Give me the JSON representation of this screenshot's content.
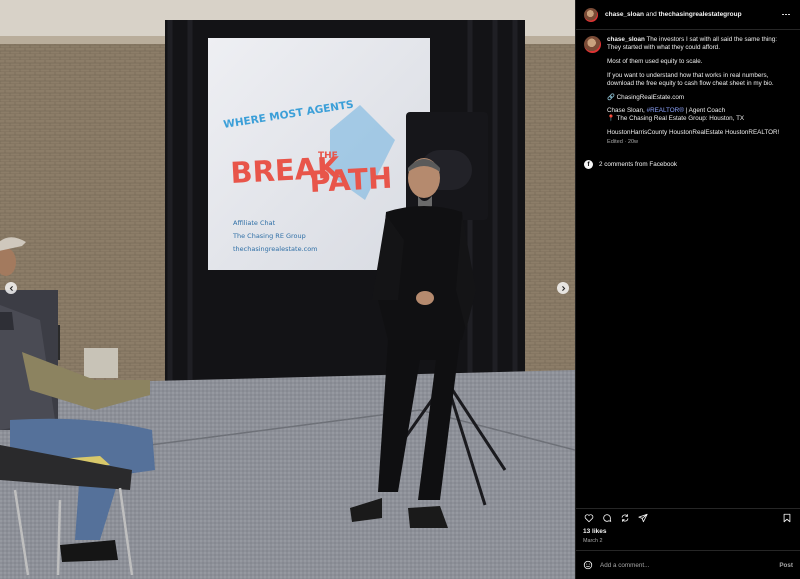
{
  "header": {
    "username": "chase_sloan",
    "conjunction": "and",
    "collaborator": "thechasingrealestategroup",
    "more_icon": "more-horizontal-icon"
  },
  "slide": {
    "line1": "WHERE MOST AGENTS",
    "line2a": "BREAK",
    "line2b": "THE",
    "line2c": "PATH",
    "small1": "Affiliate Chat",
    "small2": "The Chasing RE Group",
    "small3": "thechasingrealestate.com"
  },
  "caption": {
    "username": "chase_sloan",
    "line1": "The investors I sat with all said the same thing: They started with what they could afford.",
    "line2": "Most of them used equity to scale.",
    "line3": "If you want to understand how that works in real numbers, download the free equity to cash flow cheat sheet in my bio.",
    "link": "🔗 ChasingRealEstate.com",
    "bio_name": "Chase Sloan, ",
    "bio_tag": "#REALTOR®",
    "bio_role": " | Agent Coach",
    "location": "📍 The Chasing Real Estate Group: Houston, TX",
    "hashtags": "HoustonHarrisCounty HoustonRealEstate HoustonREALTOR!",
    "edited": "Edited · 20w"
  },
  "comments": {
    "text": "2 comments from Facebook",
    "icon": "facebook-icon"
  },
  "actions": {
    "icons": [
      "heart-icon",
      "comment-icon",
      "repost-icon",
      "share-icon",
      "bookmark-icon"
    ]
  },
  "likes": "13 likes",
  "date": "March 2",
  "comment_box": {
    "placeholder": "Add a comment...",
    "post_label": "Post",
    "emoji_icon": "emoji-icon"
  },
  "colors": {
    "background": "#000000",
    "text": "#f5f5f5",
    "muted": "#a8a8a8",
    "hashtag": "#8fa6ff",
    "slide_red": "#e8554a",
    "slide_blue": "#3b9fd8"
  }
}
